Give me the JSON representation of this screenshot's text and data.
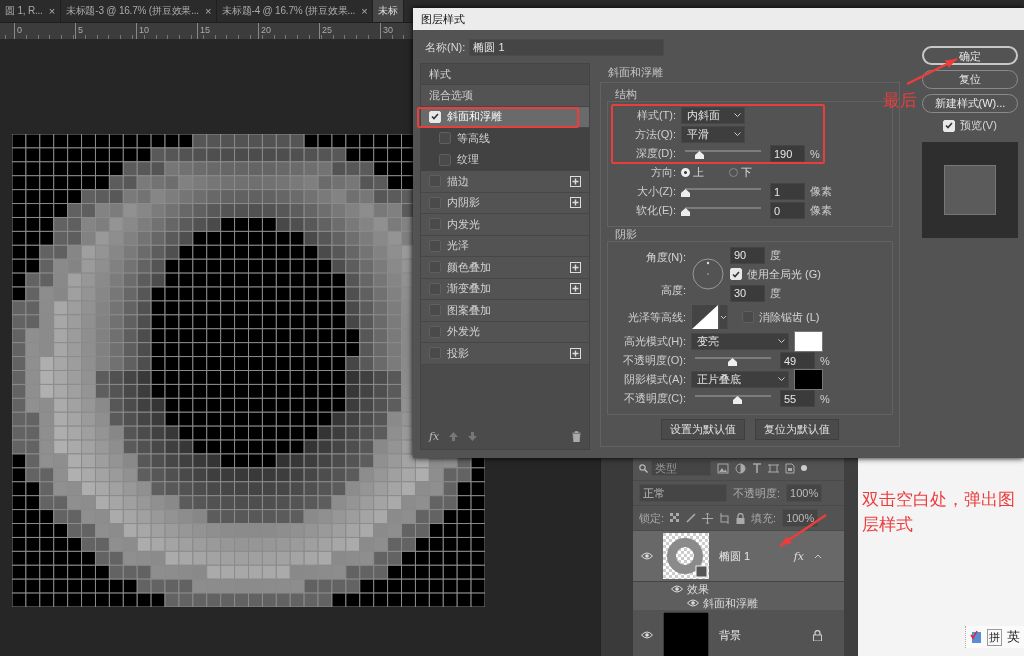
{
  "document_tabs": [
    {
      "label": "圆 1, R...",
      "close": "×",
      "selected": false
    },
    {
      "label": "未标题-3 @ 16.7% (拼豆效果...",
      "close": "×",
      "selected": false
    },
    {
      "label": "未标题-4 @ 16.7% (拼豆效果...",
      "close": "×",
      "selected": false
    },
    {
      "label": "未标",
      "selected": true
    }
  ],
  "ruler": {
    "ticks": [
      "0",
      "5",
      "10",
      "15",
      "20",
      "25",
      "30"
    ]
  },
  "dialog": {
    "title": "图层样式",
    "name_label": "名称(N):",
    "name_value": "椭圆 1",
    "styles_header": "样式",
    "styles": [
      {
        "label": "混合选项",
        "kind": "plain",
        "selected": false
      },
      {
        "label": "斜面和浮雕",
        "kind": "check",
        "checked": true,
        "selected": true,
        "addable": false
      },
      {
        "label": "等高线",
        "kind": "sub",
        "checked": false,
        "selected": false,
        "addable": false
      },
      {
        "label": "纹理",
        "kind": "sub",
        "checked": false,
        "selected": false,
        "addable": false
      },
      {
        "label": "描边",
        "kind": "check",
        "checked": false,
        "selected": false,
        "addable": true
      },
      {
        "label": "内阴影",
        "kind": "check",
        "checked": false,
        "selected": false,
        "addable": true
      },
      {
        "label": "内发光",
        "kind": "check",
        "checked": false,
        "selected": false,
        "addable": false
      },
      {
        "label": "光泽",
        "kind": "check",
        "checked": false,
        "selected": false,
        "addable": false
      },
      {
        "label": "颜色叠加",
        "kind": "check",
        "checked": false,
        "selected": false,
        "addable": true
      },
      {
        "label": "渐变叠加",
        "kind": "check",
        "checked": false,
        "selected": false,
        "addable": true
      },
      {
        "label": "图案叠加",
        "kind": "check",
        "checked": false,
        "selected": false,
        "addable": false
      },
      {
        "label": "外发光",
        "kind": "check",
        "checked": false,
        "selected": false,
        "addable": false
      },
      {
        "label": "投影",
        "kind": "check",
        "checked": false,
        "selected": false,
        "addable": true
      }
    ],
    "list_toolbar_fx": "fx",
    "bevel": {
      "title": "斜面和浮雕",
      "structure": {
        "title": "结构",
        "rows": [
          {
            "kind": "select",
            "label": "样式(T):",
            "value": "内斜面"
          },
          {
            "kind": "select",
            "label": "方法(Q):",
            "value": "平滑"
          },
          {
            "kind": "slider",
            "label": "深度(D):",
            "level": 0.19,
            "value": "190",
            "unit": "%"
          },
          {
            "kind": "radio",
            "label": "方向:",
            "options": [
              {
                "label": "上",
                "selected": true
              },
              {
                "label": "下",
                "selected": false
              }
            ]
          },
          {
            "kind": "slider",
            "label": "大小(Z):",
            "level": 0,
            "value": "1",
            "unit": "像素"
          },
          {
            "kind": "slider",
            "label": "软化(E):",
            "level": 0,
            "value": "0",
            "unit": "像素"
          }
        ]
      },
      "shading": {
        "title": "阴影",
        "angle_label": "角度(N):",
        "angle": "90",
        "angle_unit": "度",
        "global_light": {
          "label": "使用全局光 (G)",
          "checked": true
        },
        "altitude_label": "高度:",
        "altitude": "30",
        "altitude_unit": "度",
        "gloss_label": "光泽等高线:",
        "anti_alias": {
          "label": "消除锯齿 (L)",
          "checked": false
        },
        "rows": [
          {
            "kind": "mode",
            "label": "高光模式(H):",
            "value": "变亮",
            "color": "#ffffff"
          },
          {
            "kind": "slider",
            "label": "不透明度(O):",
            "level": 0.49,
            "value": "49",
            "unit": "%"
          },
          {
            "kind": "mode",
            "label": "阴影模式(A):",
            "value": "正片叠底",
            "color": "#000000"
          },
          {
            "kind": "slider",
            "label": "不透明度(C):",
            "level": 0.55,
            "value": "55",
            "unit": "%"
          }
        ]
      },
      "buttons": [
        "设置为默认值",
        "复位为默认值"
      ]
    },
    "actions": [
      {
        "label": "确定",
        "primary": true
      },
      {
        "label": "复位",
        "primary": false
      },
      {
        "label": "新建样式(W)...",
        "primary": false
      }
    ],
    "preview": {
      "label": "预览(V)",
      "checked": true
    }
  },
  "layers": {
    "filter_placeholder": "类型",
    "blend_mode": "正常",
    "opacity_label": "不透明度:",
    "opacity": "100%",
    "lock_label": "锁定:",
    "fill_label": "填充:",
    "fill": "100%",
    "items": [
      {
        "name": "椭圆 1",
        "kind": "shape",
        "selected": true,
        "fx": "fx",
        "locked": false,
        "children": [
          {
            "name": "效果",
            "children": [
              {
                "name": "斜面和浮雕"
              }
            ]
          }
        ]
      },
      {
        "name": "背景",
        "kind": "background",
        "selected": false,
        "locked": true
      }
    ]
  },
  "annotations": [
    {
      "text": "最后"
    },
    {
      "text": "双击空白处，弹出图层样式"
    }
  ],
  "ime_bar": {
    "items": [
      "拼",
      "英"
    ]
  }
}
